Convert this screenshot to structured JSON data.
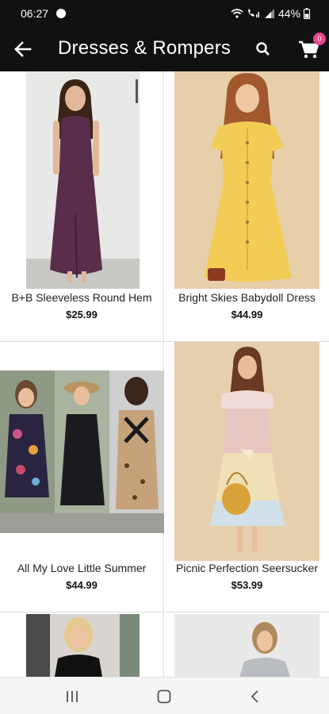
{
  "status_bar": {
    "time": "06:27",
    "battery": "44%"
  },
  "app_bar": {
    "title": "Dresses & Rompers",
    "cart_count": "0"
  },
  "products": [
    {
      "name": "B+B Sleeveless Round Hem",
      "price": "$25.99"
    },
    {
      "name": "Bright Skies Babydoll Dress",
      "price": "$44.99"
    },
    {
      "name": "All My Love Little Summer",
      "price": "$44.99"
    },
    {
      "name": "Picnic Perfection Seersucker",
      "price": "$53.99"
    }
  ],
  "icons": {
    "back": "arrow-left-icon",
    "search": "search-icon",
    "cart": "shopping-cart-icon",
    "nav": [
      "recents-icon",
      "home-icon",
      "back-icon"
    ]
  },
  "colors": {
    "app_bar": "#111111",
    "cart_badge": "#e8468a",
    "nav_bar": "#f5f5f5"
  }
}
